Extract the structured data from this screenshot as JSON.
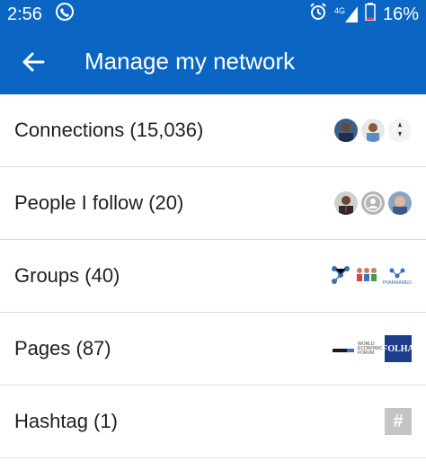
{
  "status_bar": {
    "time": "2:56",
    "network": "4G",
    "battery": "16%"
  },
  "header": {
    "title": "Manage my network"
  },
  "rows": [
    {
      "label": "Connections (15,036)"
    },
    {
      "label": "People I follow (20)"
    },
    {
      "label": "Groups (40)"
    },
    {
      "label": "Pages (87)"
    },
    {
      "label": "Hashtag (1)"
    }
  ],
  "logos": {
    "pharmamed": "PHARMAMED",
    "wef": "WORLD ECONOMIC FORUM",
    "folha": "FOLHA"
  },
  "icons": {
    "hashtag": "#"
  },
  "colors": {
    "brand": "#0a66c2"
  }
}
